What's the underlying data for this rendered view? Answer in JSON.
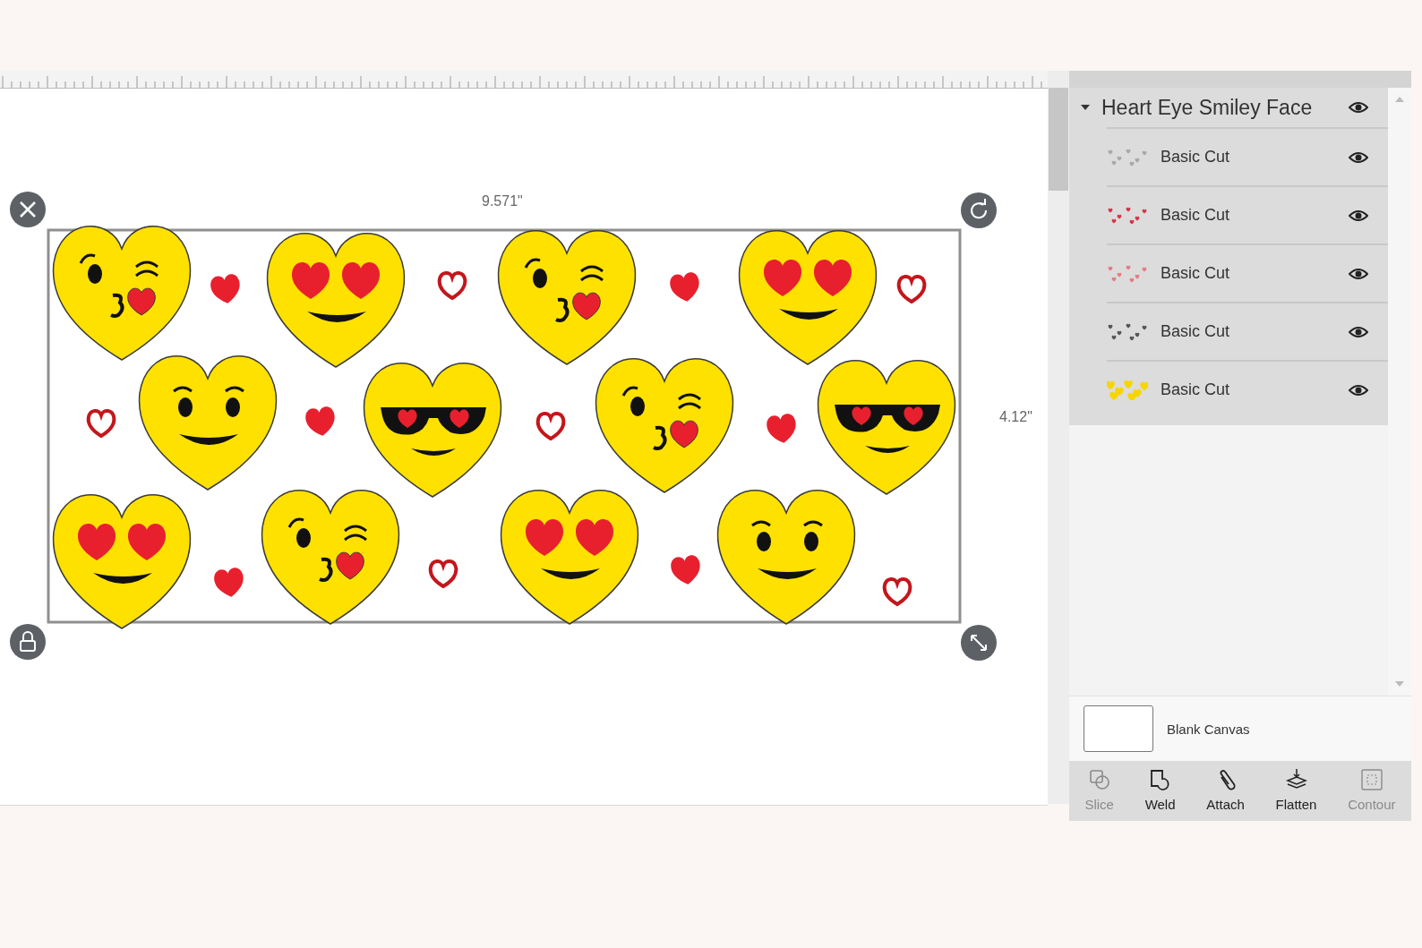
{
  "canvas": {
    "width_label": "9.571\"",
    "height_label": "4.12\""
  },
  "layers": {
    "group": {
      "name": "Heart Eye Smiley Face",
      "expanded": true,
      "visible": true
    },
    "items": [
      {
        "name": "Basic Cut",
        "visible": true,
        "color": "#a8a8a8"
      },
      {
        "name": "Basic Cut",
        "visible": true,
        "color": "#d8344a"
      },
      {
        "name": "Basic Cut",
        "visible": true,
        "color": "#e57b84"
      },
      {
        "name": "Basic Cut",
        "visible": true,
        "color": "#555555"
      },
      {
        "name": "Basic Cut",
        "visible": true,
        "color": "#f7d600"
      }
    ]
  },
  "blank_canvas": {
    "label": "Blank Canvas"
  },
  "toolbar": [
    {
      "kind": "slice",
      "label": "Slice",
      "disabled": true
    },
    {
      "kind": "weld",
      "label": "Weld",
      "disabled": false
    },
    {
      "kind": "attach",
      "label": "Attach",
      "disabled": false
    },
    {
      "kind": "flatten",
      "label": "Flatten",
      "disabled": false
    },
    {
      "kind": "contour",
      "label": "Contour",
      "disabled": true
    }
  ]
}
